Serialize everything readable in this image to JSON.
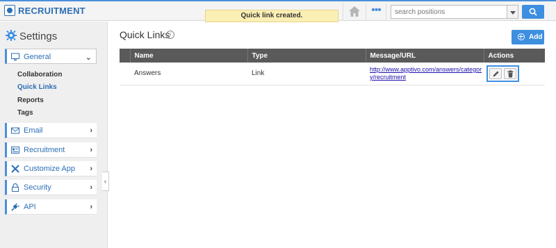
{
  "app": {
    "title": "RECRUITMENT"
  },
  "toast": "Quick link created.",
  "search": {
    "placeholder": "search positions"
  },
  "sidebar": {
    "heading": "Settings",
    "general": {
      "label": "General",
      "items": [
        "Collaboration",
        "Quick Links",
        "Reports",
        "Tags"
      ]
    },
    "items": [
      {
        "label": "Email",
        "icon": "envelope-icon"
      },
      {
        "label": "Recruitment",
        "icon": "card-icon"
      },
      {
        "label": "Customize App",
        "icon": "tools-icon"
      },
      {
        "label": "Security",
        "icon": "lock-icon"
      },
      {
        "label": "API",
        "icon": "plug-icon"
      }
    ]
  },
  "main": {
    "title": "Quick Links",
    "add_label": "Add",
    "table": {
      "headers": [
        "Name",
        "Type",
        "Message/URL",
        "Actions"
      ],
      "rows": [
        {
          "name": "Answers",
          "type": "Link",
          "url": "http://www.apptivo.com/answers/category/recruitment"
        }
      ]
    }
  },
  "colors": {
    "accent": "#3d8fe0",
    "header_bg": "#5a5a5a",
    "toast_bg": "#fcefb4"
  }
}
